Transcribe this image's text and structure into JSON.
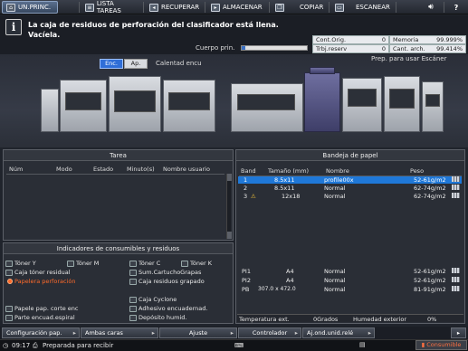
{
  "topbar": {
    "tabs": [
      {
        "label": "UN.PRINC.",
        "icon": "home-icon"
      },
      {
        "label": "LISTA TAREAS",
        "icon": "job-list-icon"
      },
      {
        "label": "RECUPERAR",
        "icon": "recall-icon"
      },
      {
        "label": "ALMACENAR",
        "icon": "store-icon"
      },
      {
        "label": "COPIAR",
        "icon": "copy-icon"
      },
      {
        "label": "ESCANEAR",
        "icon": "scan-icon"
      }
    ],
    "sound_icon": "speaker-icon",
    "help_label": "?"
  },
  "message": {
    "text": "La caja de residuos de perforación del clasificador está llena. Vacíela.",
    "cuerpo_label": "Cuerpo prin.",
    "cuerpo_fill_percent": 5
  },
  "counters": {
    "cont_orig_label": "Cont.Orig.",
    "cont_orig_value": "0",
    "memoria_label": "Memoria",
    "memoria_value": "99.999%",
    "trbj_label": "Trbj.reserv",
    "trbj_value": "0",
    "cant_label": "Cant. arch.",
    "cant_value": "99.414%"
  },
  "machine": {
    "enc_label": "Enc.",
    "ap_label": "Ap.",
    "status": "Calentad encu",
    "scanner_status": "Prep. para usar Escáner"
  },
  "tarea": {
    "title": "Tarea",
    "columns": [
      "Núm",
      "Modo",
      "Estado",
      "Minuto(s)",
      "Nombre usuario"
    ]
  },
  "bandeja": {
    "title": "Bandeja de papel",
    "columns": [
      "Band",
      "Tamaño (mm)",
      "Nombre",
      "Peso"
    ],
    "rows": [
      {
        "band": "1",
        "size": "8.5x11",
        "name": "profile00x",
        "weight": "52-61g/m2"
      },
      {
        "band": "2",
        "size": "8.5x11",
        "name": "Normal",
        "weight": "62-74g/m2"
      },
      {
        "band": "3",
        "size": "12x18",
        "name": "Normal",
        "weight": "62-74g/m2"
      },
      {
        "band": "PI1",
        "size": "A4",
        "name": "Normal",
        "weight": "52-61g/m2"
      },
      {
        "band": "PI2",
        "size": "A4",
        "name": "Normal",
        "weight": "52-61g/m2"
      },
      {
        "band": "PB",
        "size": "307.0 x 472.0",
        "name": "Normal",
        "weight": "81-91g/m2"
      }
    ],
    "temp_label": "Temperatura ext.",
    "temp_value": "0Grados",
    "hum_label": "Humedad exterior",
    "hum_value": "0%"
  },
  "consumibles": {
    "title": "Indicadores de consumibles y residuos",
    "items": [
      {
        "label": "Tóner Y",
        "icon": "toner-y-icon"
      },
      {
        "label": "Tóner M",
        "icon": "toner-m-icon"
      },
      {
        "label": "Tóner C",
        "icon": "toner-c-icon"
      },
      {
        "label": "Tóner K",
        "icon": "toner-k-icon"
      },
      {
        "label": "Caja tóner residual",
        "icon": "waste-toner-icon"
      },
      {
        "label": "Sum.CartuchoGrapas",
        "icon": "staple-cartridge-icon"
      },
      {
        "label": "Papelera perforación",
        "icon": "alert-icon"
      },
      {
        "label": "Caja residuos grapado",
        "icon": "staple-waste-icon"
      },
      {
        "label": "Caja Cyclone",
        "icon": "cyclone-icon"
      },
      {
        "label": "Papele pap. corte enc",
        "icon": "trim-waste-icon"
      },
      {
        "label": "Adhesivo encuadernad.",
        "icon": "adhesive-icon"
      },
      {
        "label": "Parte encuad.espiral",
        "icon": "coil-icon"
      },
      {
        "label": "Depósito humid.",
        "icon": "humid-tank-icon"
      }
    ]
  },
  "bottom_tabs": [
    {
      "label": "Configuración pap."
    },
    {
      "label": "Ambas caras"
    },
    {
      "label": "Ajuste"
    },
    {
      "label": "Controlador"
    },
    {
      "label": "Aj.ond.unid.relé"
    }
  ],
  "status": {
    "time": "09:17",
    "text": "Preparada para recibir",
    "consumible_label": "Consumible"
  },
  "colors": {
    "accent": "#1f78d8",
    "alert": "#ff6a2a"
  }
}
